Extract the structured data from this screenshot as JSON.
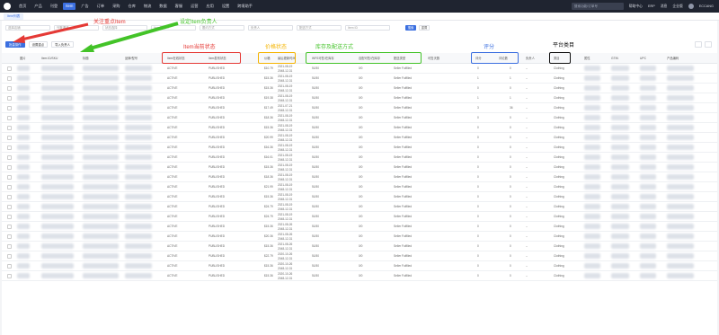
{
  "topbar": {
    "nav": [
      "首页",
      "产品",
      "刊登",
      "Item",
      "广告",
      "订单",
      "采购",
      "仓库",
      "物流",
      "数据",
      "客服",
      "运营",
      "应用",
      "设置",
      "跨境助手"
    ],
    "active_index": 3,
    "search_placeholder": "搜索功能/订单号",
    "links": [
      "帮助中心",
      "ERP",
      "消息",
      "企业版"
    ],
    "user": "ECCANG"
  },
  "tabbar": {
    "tab": "Item列表"
  },
  "filters": {
    "selects": [
      "选择店铺",
      "刊登渠道",
      "状态选择",
      "Item负责人",
      "履约方式",
      "负责人",
      "配送方式",
      "Item ID"
    ],
    "search_label": "搜索",
    "reset_label": "重置"
  },
  "actions": {
    "primary": "批量操作",
    "second": "设置重点",
    "third": "导入负责人"
  },
  "annotations": {
    "focus_item": "关注重点Item",
    "set_owner": "设定Item负责人",
    "item_status": "Item当前状态",
    "price_status": "价格状态",
    "stock": "库存及配送方式",
    "rating": "评分",
    "category": "平台类目"
  },
  "table": {
    "headers": {
      "image": "图片",
      "item_id": "Item ID/SKU",
      "title": "标题",
      "brand": "品牌/型号",
      "item_status": "Item在线状态",
      "publish_status": "Item发布状态",
      "price": "价格",
      "update_time": "最后更新时间",
      "wfs_stock": "WFS可售/在库存",
      "seller_stock": "自配可售/在库存",
      "fulfillment": "配送类型",
      "sell_days": "可售天数",
      "rating": "评分",
      "reviews": "评论数",
      "owner": "负责人",
      "category": "类目",
      "attr": "属性",
      "gtin": "GTIN",
      "upc": "UPC",
      "product_id": "产品编码"
    },
    "rows": [
      {
        "status": "ACTIVE",
        "publish": "PUBLISHED",
        "price": "$10.79",
        "t1": "2021-08-19",
        "t2": "2048-12-31",
        "wfs": "51/50",
        "seller": "0/0",
        "ful": "Seller Fulfilled",
        "rating": "0",
        "reviews": "0",
        "owner": "--",
        "cat": "Clothing"
      },
      {
        "status": "ACTIVE",
        "publish": "PUBLISHED",
        "price": "$15.36",
        "t1": "2021-08-19",
        "t2": "2048-12-31",
        "wfs": "51/50",
        "seller": "0/0",
        "ful": "Seller Fulfilled",
        "rating": "1",
        "reviews": "1",
        "owner": "--",
        "cat": "Clothing"
      },
      {
        "status": "ACTIVE",
        "publish": "PUBLISHED",
        "price": "$15.36",
        "t1": "2021-08-19",
        "t2": "2048-12-31",
        "wfs": "51/50",
        "seller": "0/0",
        "ful": "Seller Fulfilled",
        "rating": "0",
        "reviews": "0",
        "owner": "--",
        "cat": "Clothing"
      },
      {
        "status": "ACTIVE",
        "publish": "PUBLISHED",
        "price": "$19.38",
        "t1": "2021-08-19",
        "t2": "2048-12-31",
        "wfs": "51/50",
        "seller": "0/0",
        "ful": "Seller Fulfilled",
        "rating": "1",
        "reviews": "1",
        "owner": "--",
        "cat": "Clothing"
      },
      {
        "status": "ACTIVE",
        "publish": "PUBLISHED",
        "price": "$17.49",
        "t1": "2021-07-21",
        "t2": "2048-12-31",
        "wfs": "51/50",
        "seller": "0/0",
        "ful": "Seller Fulfilled",
        "rating": "3",
        "reviews": "36",
        "owner": "--",
        "cat": "Clothing"
      },
      {
        "status": "ACTIVE",
        "publish": "PUBLISHED",
        "price": "$18.36",
        "t1": "2021-08-19",
        "t2": "2048-12-31",
        "wfs": "51/50",
        "seller": "0/0",
        "ful": "Seller Fulfilled",
        "rating": "0",
        "reviews": "0",
        "owner": "--",
        "cat": "Clothing"
      },
      {
        "status": "ACTIVE",
        "publish": "PUBLISHED",
        "price": "$15.36",
        "t1": "2021-08-19",
        "t2": "2048-12-31",
        "wfs": "51/50",
        "seller": "0/0",
        "ful": "Seller Fulfilled",
        "rating": "0",
        "reviews": "0",
        "owner": "--",
        "cat": "Clothing"
      },
      {
        "status": "ACTIVE",
        "publish": "PUBLISHED",
        "price": "$20.99",
        "t1": "2021-08-19",
        "t2": "2048-12-31",
        "wfs": "51/50",
        "seller": "0/0",
        "ful": "Seller Fulfilled",
        "rating": "0",
        "reviews": "0",
        "owner": "--",
        "cat": "Clothing"
      },
      {
        "status": "ACTIVE",
        "publish": "PUBLISHED",
        "price": "$16.36",
        "t1": "2021-08-19",
        "t2": "2048-12-31",
        "wfs": "51/50",
        "seller": "0/0",
        "ful": "Seller Fulfilled",
        "rating": "0",
        "reviews": "0",
        "owner": "--",
        "cat": "Clothing"
      },
      {
        "status": "ACTIVE",
        "publish": "PUBLISHED",
        "price": "$16.01",
        "t1": "2021-08-19",
        "t2": "2048-12-31",
        "wfs": "51/50",
        "seller": "0/0",
        "ful": "Seller Fulfilled",
        "rating": "0",
        "reviews": "0",
        "owner": "--",
        "cat": "Clothing"
      },
      {
        "status": "ACTIVE",
        "publish": "PUBLISHED",
        "price": "$15.36",
        "t1": "2021-08-19",
        "t2": "2048-12-31",
        "wfs": "51/50",
        "seller": "0/0",
        "ful": "Seller Fulfilled",
        "rating": "0",
        "reviews": "0",
        "owner": "--",
        "cat": "Clothing"
      },
      {
        "status": "ACTIVE",
        "publish": "PUBLISHED",
        "price": "$18.36",
        "t1": "2021-08-19",
        "t2": "2048-12-31",
        "wfs": "51/50",
        "seller": "0/0",
        "ful": "Seller Fulfilled",
        "rating": "0",
        "reviews": "0",
        "owner": "--",
        "cat": "Clothing"
      },
      {
        "status": "ACTIVE",
        "publish": "PUBLISHED",
        "price": "$21.99",
        "t1": "2021-08-19",
        "t2": "2048-12-31",
        "wfs": "51/50",
        "seller": "0/0",
        "ful": "Seller Fulfilled",
        "rating": "0",
        "reviews": "0",
        "owner": "--",
        "cat": "Clothing"
      },
      {
        "status": "ACTIVE",
        "publish": "PUBLISHED",
        "price": "$15.36",
        "t1": "2021-08-19",
        "t2": "2048-12-31",
        "wfs": "51/50",
        "seller": "0/0",
        "ful": "Seller Fulfilled",
        "rating": "0",
        "reviews": "0",
        "owner": "--",
        "cat": "Clothing"
      },
      {
        "status": "ACTIVE",
        "publish": "PUBLISHED",
        "price": "$24.79",
        "t1": "2021-08-19",
        "t2": "2048-12-31",
        "wfs": "51/50",
        "seller": "0/0",
        "ful": "Seller Fulfilled",
        "rating": "0",
        "reviews": "0",
        "owner": "--",
        "cat": "Clothing"
      },
      {
        "status": "ACTIVE",
        "publish": "PUBLISHED",
        "price": "$24.79",
        "t1": "2021-08-19",
        "t2": "2048-12-31",
        "wfs": "51/50",
        "seller": "0/0",
        "ful": "Seller Fulfilled",
        "rating": "0",
        "reviews": "0",
        "owner": "--",
        "cat": "Clothing"
      },
      {
        "status": "ACTIVE",
        "publish": "PUBLISHED",
        "price": "$15.36",
        "t1": "2021-08-26",
        "t2": "2048-12-31",
        "wfs": "51/50",
        "seller": "0/0",
        "ful": "Seller Fulfilled",
        "rating": "0",
        "reviews": "0",
        "owner": "--",
        "cat": "Clothing"
      },
      {
        "status": "ACTIVE",
        "publish": "PUBLISHED",
        "price": "$20.36",
        "t1": "2021-08-26",
        "t2": "2048-12-31",
        "wfs": "51/50",
        "seller": "0/0",
        "ful": "Seller Fulfilled",
        "rating": "0",
        "reviews": "0",
        "owner": "--",
        "cat": "Clothing"
      },
      {
        "status": "ACTIVE",
        "publish": "PUBLISHED",
        "price": "$15.36",
        "t1": "2021-08-26",
        "t2": "2048-12-31",
        "wfs": "51/50",
        "seller": "0/0",
        "ful": "Seller Fulfilled",
        "rating": "0",
        "reviews": "0",
        "owner": "--",
        "cat": "Clothing"
      },
      {
        "status": "ACTIVE",
        "publish": "PUBLISHED",
        "price": "$22.79",
        "t1": "2020-10-26",
        "t2": "2048-12-31",
        "wfs": "51/50",
        "seller": "0/0",
        "ful": "Seller Fulfilled",
        "rating": "0",
        "reviews": "0",
        "owner": "--",
        "cat": "Clothing"
      },
      {
        "status": "ACTIVE",
        "publish": "PUBLISHED",
        "price": "$15.36",
        "t1": "2020-10-26",
        "t2": "2048-12-31",
        "wfs": "51/50",
        "seller": "0/0",
        "ful": "Seller Fulfilled",
        "rating": "0",
        "reviews": "0",
        "owner": "--",
        "cat": "Clothing"
      },
      {
        "status": "ACTIVE",
        "publish": "PUBLISHED",
        "price": "$15.36",
        "t1": "2020-10-26",
        "t2": "2048-12-31",
        "wfs": "51/50",
        "seller": "0/0",
        "ful": "Seller Fulfilled",
        "rating": "0",
        "reviews": "0",
        "owner": "--",
        "cat": "Clothing"
      }
    ]
  },
  "colors": {
    "nav_bg": "#1f2430",
    "primary": "#3b6fe0",
    "red": "#e53935",
    "green": "#43c328",
    "orange": "#f5b400",
    "blue": "#3b6fe0",
    "black": "#111111"
  }
}
